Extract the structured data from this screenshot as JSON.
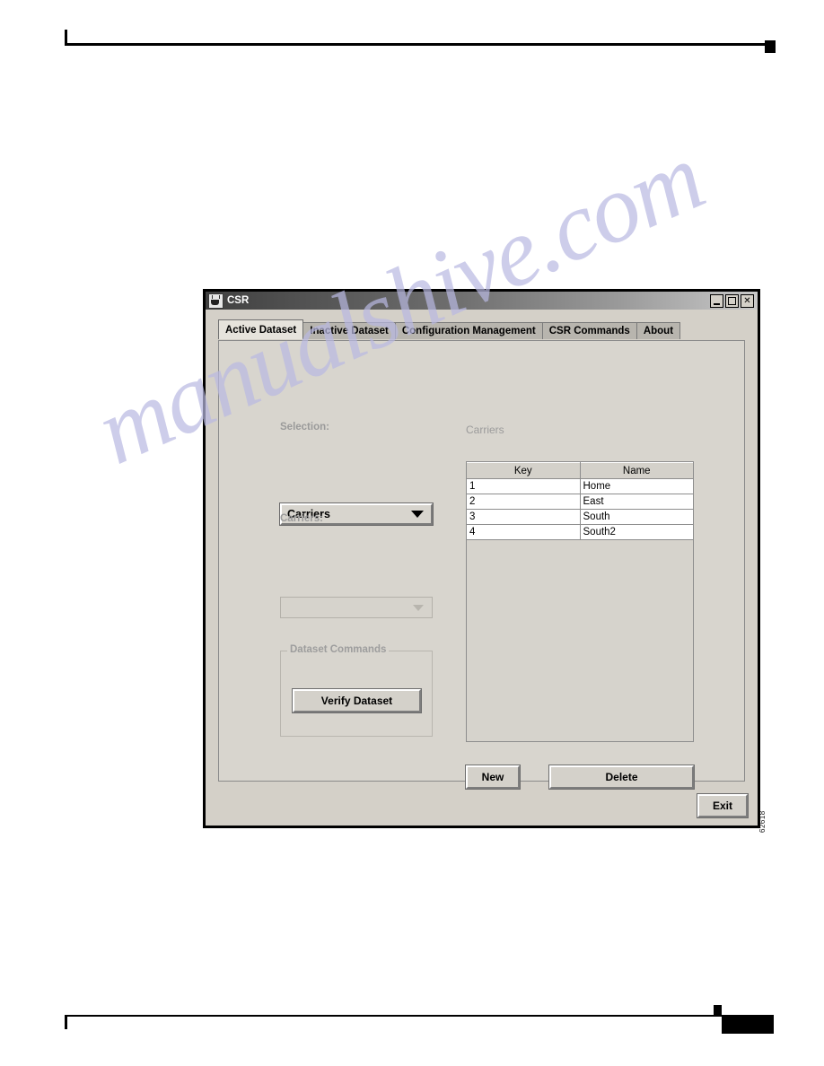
{
  "page": {
    "figure_id": "62618",
    "watermark": "manualshive.com"
  },
  "window": {
    "title": "CSR",
    "app_icon": "java-coffee-cup-icon",
    "controls": {
      "minimize": "_",
      "maximize": "□",
      "close": "✕"
    }
  },
  "tabs": [
    {
      "label": "Active Dataset",
      "selected": true
    },
    {
      "label": "Inactive Dataset",
      "selected": false
    },
    {
      "label": "Configuration Management",
      "selected": false
    },
    {
      "label": "CSR Commands",
      "selected": false
    },
    {
      "label": "About",
      "selected": false
    }
  ],
  "left_panel": {
    "selection_label": "Selection:",
    "selection_combo": {
      "value": "Carriers",
      "enabled": true,
      "arrow_icon": "chevron-down-icon"
    },
    "carriers_label": "Carriers:",
    "carriers_combo": {
      "value": "",
      "enabled": false,
      "arrow_icon": "chevron-down-icon"
    },
    "group": {
      "title": "Dataset Commands",
      "verify_button": "Verify Dataset"
    }
  },
  "right_panel": {
    "heading": "Carriers",
    "table": {
      "columns": [
        "Key",
        "Name"
      ],
      "rows": [
        {
          "key": "1",
          "name": "Home"
        },
        {
          "key": "2",
          "name": "East"
        },
        {
          "key": "3",
          "name": "South"
        },
        {
          "key": "4",
          "name": "South2"
        }
      ]
    },
    "new_button": "New",
    "delete_button": "Delete"
  },
  "footer": {
    "exit_button": "Exit"
  }
}
